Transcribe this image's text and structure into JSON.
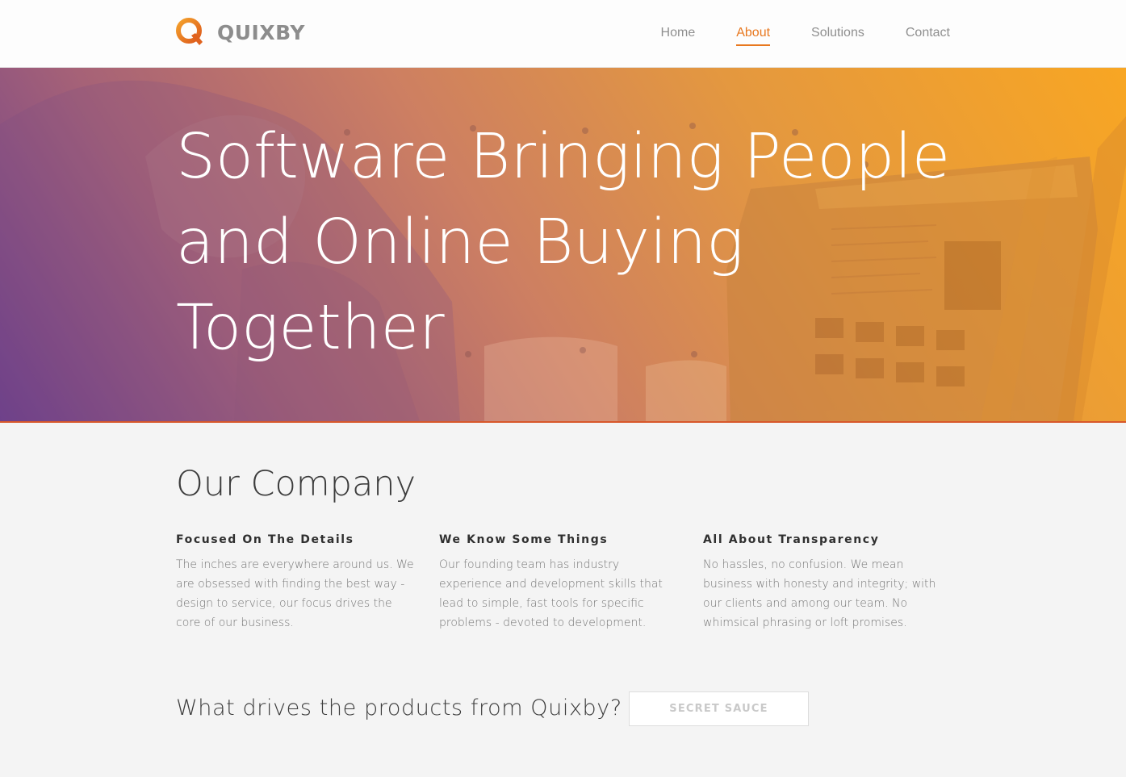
{
  "header": {
    "logo_text": "QUIXBY",
    "nav": [
      {
        "label": "Home",
        "active": false
      },
      {
        "label": "About",
        "active": true
      },
      {
        "label": "Solutions",
        "active": false
      },
      {
        "label": "Contact",
        "active": false
      }
    ]
  },
  "hero": {
    "title": "Software Bringing People and Online Buying Together"
  },
  "company": {
    "title": "Our Company",
    "columns": [
      {
        "heading": "Focused On The Details",
        "text": "The inches are everywhere around us. We are obsessed with finding the best way - design to service, our focus drives the core of our business."
      },
      {
        "heading": "We Know Some Things",
        "text": "Our founding team has industry experience and development skills that lead to simple, fast tools for specific problems - devoted to development."
      },
      {
        "heading": "All About Transparency",
        "text": "No hassles, no confusion. We mean business with honesty and integrity; with our clients and among our team. No whimsical phrasing or loft promises."
      }
    ]
  },
  "cta": {
    "question": "What drives the products from Quixby?",
    "button_label": "SECRET SAUCE"
  },
  "colors": {
    "accent": "#e8781f",
    "hero_gradient_start": "#6b3e8c",
    "hero_gradient_end": "#f8a623",
    "background": "#f4f4f4"
  },
  "icons": {
    "logo": "quixby-q-logo-icon"
  }
}
